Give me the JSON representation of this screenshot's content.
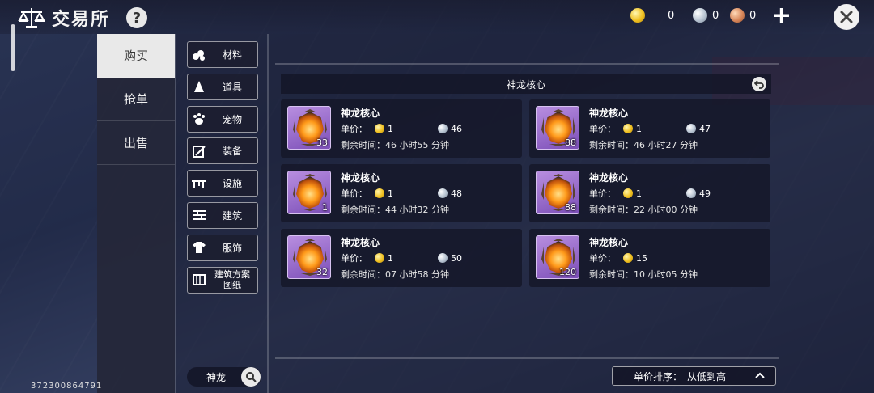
{
  "header": {
    "title": "交易所",
    "help": "?"
  },
  "currencies": {
    "gold": "0",
    "silver": "0",
    "copper": "0"
  },
  "main_tabs": [
    {
      "label": "购买",
      "active": true
    },
    {
      "label": "抢单",
      "active": false
    },
    {
      "label": "出售",
      "active": false
    }
  ],
  "categories": [
    {
      "label": "材料",
      "icon": "materials-icon"
    },
    {
      "label": "道具",
      "icon": "props-icon"
    },
    {
      "label": "宠物",
      "icon": "paw-icon"
    },
    {
      "label": "装备",
      "icon": "equipment-icon"
    },
    {
      "label": "设施",
      "icon": "facility-icon"
    },
    {
      "label": "建筑",
      "icon": "building-icon"
    },
    {
      "label": "服饰",
      "icon": "clothing-icon"
    },
    {
      "label": "建筑方案\n图纸",
      "icon": "blueprint-icon"
    }
  ],
  "search": {
    "value": "神龙"
  },
  "list": {
    "header": "神龙核心",
    "price_label": "单价：",
    "time_label": "剩余时间：",
    "items": [
      {
        "name": "神龙核心",
        "qty": "33",
        "gold": "1",
        "silver": "46",
        "time": "46 小时55 分钟"
      },
      {
        "name": "神龙核心",
        "qty": "88",
        "gold": "1",
        "silver": "47",
        "time": "46 小时27 分钟"
      },
      {
        "name": "神龙核心",
        "qty": "1",
        "gold": "1",
        "silver": "48",
        "time": "44 小时32 分钟"
      },
      {
        "name": "神龙核心",
        "qty": "88",
        "gold": "1",
        "silver": "49",
        "time": "22 小时00 分钟"
      },
      {
        "name": "神龙核心",
        "qty": "32",
        "gold": "1",
        "silver": "50",
        "time": "07 小时58 分钟"
      },
      {
        "name": "神龙核心",
        "qty": "120",
        "gold": "15",
        "silver": null,
        "time": "10 小时05 分钟"
      }
    ]
  },
  "sort": {
    "label": "单价排序：",
    "value": "从低到高"
  },
  "uid": "372300864791"
}
